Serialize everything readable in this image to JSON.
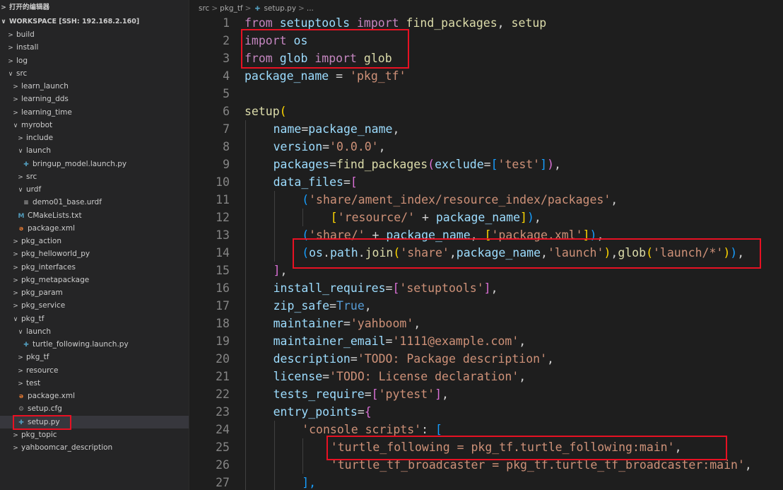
{
  "sidebar": {
    "open_editors_label": "打开的编辑器",
    "workspace_label": "WORKSPACE [SSH: 192.168.2.160]",
    "tree": [
      {
        "label": "build",
        "depth": 0,
        "kind": "folder",
        "open": false
      },
      {
        "label": "install",
        "depth": 0,
        "kind": "folder",
        "open": false
      },
      {
        "label": "log",
        "depth": 0,
        "kind": "folder",
        "open": false
      },
      {
        "label": "src",
        "depth": 0,
        "kind": "folder",
        "open": true
      },
      {
        "label": "learn_launch",
        "depth": 1,
        "kind": "folder",
        "open": false
      },
      {
        "label": "learning_dds",
        "depth": 1,
        "kind": "folder",
        "open": false
      },
      {
        "label": "learning_time",
        "depth": 1,
        "kind": "folder",
        "open": false
      },
      {
        "label": "myrobot",
        "depth": 1,
        "kind": "folder",
        "open": true
      },
      {
        "label": "include",
        "depth": 2,
        "kind": "folder",
        "open": false
      },
      {
        "label": "launch",
        "depth": 2,
        "kind": "folder",
        "open": true
      },
      {
        "label": "bringup_model.launch.py",
        "depth": 3,
        "kind": "py"
      },
      {
        "label": "src",
        "depth": 2,
        "kind": "folder",
        "open": false
      },
      {
        "label": "urdf",
        "depth": 2,
        "kind": "folder",
        "open": true
      },
      {
        "label": "demo01_base.urdf",
        "depth": 3,
        "kind": "urdf"
      },
      {
        "label": "CMakeLists.txt",
        "depth": 2,
        "kind": "cmake"
      },
      {
        "label": "package.xml",
        "depth": 2,
        "kind": "xml"
      },
      {
        "label": "pkg_action",
        "depth": 1,
        "kind": "folder",
        "open": false
      },
      {
        "label": "pkg_helloworld_py",
        "depth": 1,
        "kind": "folder",
        "open": false
      },
      {
        "label": "pkg_interfaces",
        "depth": 1,
        "kind": "folder",
        "open": false
      },
      {
        "label": "pkg_metapackage",
        "depth": 1,
        "kind": "folder",
        "open": false
      },
      {
        "label": "pkg_param",
        "depth": 1,
        "kind": "folder",
        "open": false
      },
      {
        "label": "pkg_service",
        "depth": 1,
        "kind": "folder",
        "open": false
      },
      {
        "label": "pkg_tf",
        "depth": 1,
        "kind": "folder",
        "open": true
      },
      {
        "label": "launch",
        "depth": 2,
        "kind": "folder",
        "open": true
      },
      {
        "label": "turtle_following.launch.py",
        "depth": 3,
        "kind": "py"
      },
      {
        "label": "pkg_tf",
        "depth": 2,
        "kind": "folder",
        "open": false
      },
      {
        "label": "resource",
        "depth": 2,
        "kind": "folder",
        "open": false
      },
      {
        "label": "test",
        "depth": 2,
        "kind": "folder",
        "open": false
      },
      {
        "label": "package.xml",
        "depth": 2,
        "kind": "xml"
      },
      {
        "label": "setup.cfg",
        "depth": 2,
        "kind": "cfg"
      },
      {
        "label": "setup.py",
        "depth": 2,
        "kind": "py",
        "selected": true
      },
      {
        "label": "pkg_topic",
        "depth": 1,
        "kind": "folder",
        "open": false
      },
      {
        "label": "yahboomcar_description",
        "depth": 1,
        "kind": "folder",
        "open": false
      }
    ]
  },
  "breadcrumb": {
    "parts": [
      "src",
      "pkg_tf",
      "setup.py",
      "..."
    ]
  },
  "editor": {
    "lines": [
      {
        "n": "1",
        "indent": 0,
        "tokens": [
          [
            "kw",
            "from"
          ],
          [
            "op",
            " "
          ],
          [
            "var",
            "setuptools"
          ],
          [
            "op",
            " "
          ],
          [
            "kw",
            "import"
          ],
          [
            "op",
            " "
          ],
          [
            "fn",
            "find_packages"
          ],
          [
            "op",
            ", "
          ],
          [
            "fn",
            "setup"
          ]
        ]
      },
      {
        "n": "2",
        "indent": 0,
        "tokens": [
          [
            "kw",
            "import"
          ],
          [
            "op",
            " "
          ],
          [
            "var",
            "os"
          ]
        ]
      },
      {
        "n": "3",
        "indent": 0,
        "tokens": [
          [
            "kw",
            "from"
          ],
          [
            "op",
            " "
          ],
          [
            "var",
            "glob"
          ],
          [
            "op",
            " "
          ],
          [
            "kw",
            "import"
          ],
          [
            "op",
            " "
          ],
          [
            "fn",
            "glob"
          ]
        ]
      },
      {
        "n": "4",
        "indent": 0,
        "tokens": [
          [
            "var",
            "package_name"
          ],
          [
            "op",
            " = "
          ],
          [
            "str",
            "'pkg_tf'"
          ]
        ]
      },
      {
        "n": "5",
        "indent": 0,
        "tokens": []
      },
      {
        "n": "6",
        "indent": 0,
        "tokens": [
          [
            "fn",
            "setup"
          ],
          [
            "b1",
            "("
          ]
        ]
      },
      {
        "n": "7",
        "indent": 1,
        "tokens": [
          [
            "var",
            "name"
          ],
          [
            "op",
            "="
          ],
          [
            "var",
            "package_name"
          ],
          [
            "op",
            ","
          ]
        ]
      },
      {
        "n": "8",
        "indent": 1,
        "tokens": [
          [
            "var",
            "version"
          ],
          [
            "op",
            "="
          ],
          [
            "str",
            "'0.0.0'"
          ],
          [
            "op",
            ","
          ]
        ]
      },
      {
        "n": "9",
        "indent": 1,
        "tokens": [
          [
            "var",
            "packages"
          ],
          [
            "op",
            "="
          ],
          [
            "fn",
            "find_packages"
          ],
          [
            "b2",
            "("
          ],
          [
            "var",
            "exclude"
          ],
          [
            "op",
            "="
          ],
          [
            "b3",
            "["
          ],
          [
            "str",
            "'test'"
          ],
          [
            "b3",
            "]"
          ],
          [
            "b2",
            ")"
          ],
          [
            "op",
            ","
          ]
        ]
      },
      {
        "n": "10",
        "indent": 1,
        "tokens": [
          [
            "var",
            "data_files"
          ],
          [
            "op",
            "="
          ],
          [
            "b2",
            "["
          ]
        ]
      },
      {
        "n": "11",
        "indent": 2,
        "tokens": [
          [
            "b3",
            "("
          ],
          [
            "str",
            "'share/ament_index/resource_index/packages'"
          ],
          [
            "op",
            ","
          ]
        ]
      },
      {
        "n": "12",
        "indent": 3,
        "tokens": [
          [
            "b1",
            "["
          ],
          [
            "str",
            "'resource/'"
          ],
          [
            "op",
            " + "
          ],
          [
            "var",
            "package_name"
          ],
          [
            "b1",
            "]"
          ],
          [
            "b3",
            ")"
          ],
          [
            "op",
            ","
          ]
        ]
      },
      {
        "n": "13",
        "indent": 2,
        "tokens": [
          [
            "b3",
            "("
          ],
          [
            "str",
            "'share/'"
          ],
          [
            "op",
            " + "
          ],
          [
            "var",
            "package_name"
          ],
          [
            "op",
            ", "
          ],
          [
            "b1",
            "["
          ],
          [
            "str",
            "'package.xml'"
          ],
          [
            "b1",
            "]"
          ],
          [
            "b3",
            ")"
          ],
          [
            "op",
            ","
          ]
        ]
      },
      {
        "n": "14",
        "indent": 2,
        "tokens": [
          [
            "b3",
            "("
          ],
          [
            "var",
            "os"
          ],
          [
            "op",
            "."
          ],
          [
            "var",
            "path"
          ],
          [
            "op",
            "."
          ],
          [
            "fn",
            "join"
          ],
          [
            "b1",
            "("
          ],
          [
            "str",
            "'share'"
          ],
          [
            "op",
            ","
          ],
          [
            "var",
            "package_name"
          ],
          [
            "op",
            ","
          ],
          [
            "str",
            "'launch'"
          ],
          [
            "b1",
            ")"
          ],
          [
            "op",
            ","
          ],
          [
            "fn",
            "glob"
          ],
          [
            "b1",
            "("
          ],
          [
            "str",
            "'launch/*'"
          ],
          [
            "b1",
            ")"
          ],
          [
            "b3",
            ")"
          ],
          [
            "op",
            ","
          ]
        ]
      },
      {
        "n": "15",
        "indent": 1,
        "tokens": [
          [
            "b2",
            "]"
          ],
          [
            "op",
            ","
          ]
        ]
      },
      {
        "n": "16",
        "indent": 1,
        "tokens": [
          [
            "var",
            "install_requires"
          ],
          [
            "op",
            "="
          ],
          [
            "b2",
            "["
          ],
          [
            "str",
            "'setuptools'"
          ],
          [
            "b2",
            "]"
          ],
          [
            "op",
            ","
          ]
        ]
      },
      {
        "n": "17",
        "indent": 1,
        "tokens": [
          [
            "var",
            "zip_safe"
          ],
          [
            "op",
            "="
          ],
          [
            "const",
            "True"
          ],
          [
            "op",
            ","
          ]
        ]
      },
      {
        "n": "18",
        "indent": 1,
        "tokens": [
          [
            "var",
            "maintainer"
          ],
          [
            "op",
            "="
          ],
          [
            "str",
            "'yahboom'"
          ],
          [
            "op",
            ","
          ]
        ]
      },
      {
        "n": "19",
        "indent": 1,
        "tokens": [
          [
            "var",
            "maintainer_email"
          ],
          [
            "op",
            "="
          ],
          [
            "str",
            "'1111@example.com'"
          ],
          [
            "op",
            ","
          ]
        ]
      },
      {
        "n": "20",
        "indent": 1,
        "tokens": [
          [
            "var",
            "description"
          ],
          [
            "op",
            "="
          ],
          [
            "str",
            "'TODO: Package description'"
          ],
          [
            "op",
            ","
          ]
        ]
      },
      {
        "n": "21",
        "indent": 1,
        "tokens": [
          [
            "var",
            "license"
          ],
          [
            "op",
            "="
          ],
          [
            "str",
            "'TODO: License declaration'"
          ],
          [
            "op",
            ","
          ]
        ]
      },
      {
        "n": "22",
        "indent": 1,
        "tokens": [
          [
            "var",
            "tests_require"
          ],
          [
            "op",
            "="
          ],
          [
            "b2",
            "["
          ],
          [
            "str",
            "'pytest'"
          ],
          [
            "b2",
            "]"
          ],
          [
            "op",
            ","
          ]
        ]
      },
      {
        "n": "23",
        "indent": 1,
        "tokens": [
          [
            "var",
            "entry_points"
          ],
          [
            "op",
            "="
          ],
          [
            "b2",
            "{"
          ]
        ]
      },
      {
        "n": "24",
        "indent": 2,
        "tokens": [
          [
            "str",
            "'console_scripts'"
          ],
          [
            "op",
            ": "
          ],
          [
            "b3",
            "["
          ]
        ]
      },
      {
        "n": "25",
        "indent": 3,
        "tokens": [
          [
            "str",
            "'turtle_following = pkg_tf.turtle_following:main'"
          ],
          [
            "op",
            ","
          ]
        ]
      },
      {
        "n": "26",
        "indent": 3,
        "tokens": [
          [
            "str",
            "'turtle_tf_broadcaster = pkg_tf.turtle_tf_broadcaster:main'"
          ],
          [
            "op",
            ","
          ]
        ]
      },
      {
        "n": "27",
        "indent": 2,
        "tokens": [
          [
            "b3",
            "],"
          ]
        ]
      }
    ]
  },
  "colors": {
    "highlight_box": "#e81123",
    "editor_bg": "#1e1e1e",
    "sidebar_bg": "#252526",
    "selected_row": "#37373d"
  }
}
